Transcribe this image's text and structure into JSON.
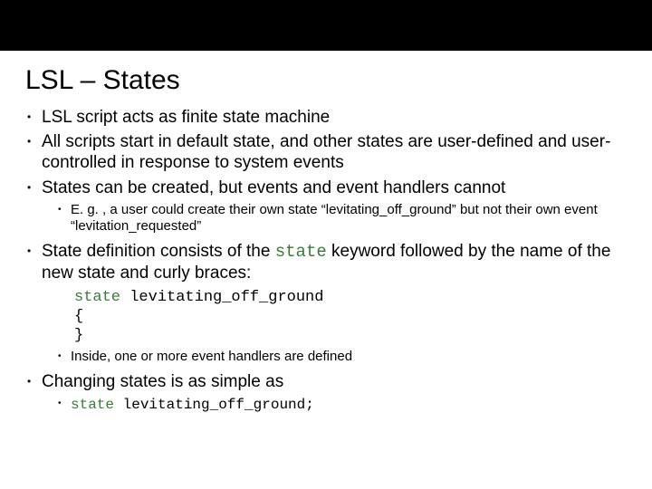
{
  "slide": {
    "title": "LSL – States",
    "bullets": {
      "b1": "LSL script acts as finite state machine",
      "b2_a": "All scripts start in ",
      "b2_default": "default",
      "b2_b": " state, and other states are user-defined and user-controlled in response to system events",
      "b3": "States can be created, but events and event handlers cannot",
      "b3_sub": "E. g. , a user could create their own state “levitating_off_ground” but not their own event “levitation_requested”",
      "b4_a": "State definition consists of the ",
      "b4_state": "state",
      "b4_b": " keyword followed by the name of the new state and curly braces:",
      "code_line1_kw": "state ",
      "code_line1_id": "levitating_off_ground",
      "code_line2": "{",
      "code_line3": "}",
      "b4_sub": "Inside, one or more event handlers are defined",
      "b5": "Changing states is as simple as",
      "b5_sub_kw": "state ",
      "b5_sub_id": " levitating_off_ground;"
    }
  }
}
